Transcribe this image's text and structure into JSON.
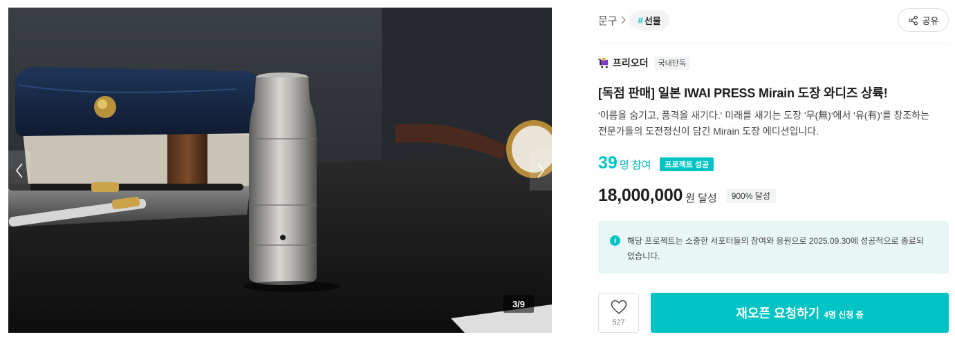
{
  "gallery": {
    "counter": "3/9",
    "prev_icon": "chevron-left-icon",
    "next_icon": "chevron-right-icon"
  },
  "breadcrumb": {
    "category": "문구",
    "tag_hash": "#",
    "tag": "선물"
  },
  "share": {
    "label": "공유",
    "icon": "share-icon"
  },
  "maker": {
    "name": "프리오더",
    "badge": "국내단독",
    "icon": "cart-logo-icon"
  },
  "project": {
    "title": "[독점 판매] 일본 IWAI PRESS Mirain 도장 와디즈 상륙!",
    "description": "'이름을 숨기고, 품격을 새기다.' 미래를 새기는 도장 '무(無)'에서 '유(有)'를 창조하는 전문가들의 도전정신이 담긴 Mirain 도장 에디션입니다."
  },
  "stats": {
    "participants": "39",
    "participants_unit": "명 참여",
    "status_badge": "프로젝트 성공",
    "amount": "18,000,000",
    "amount_unit": "원 달성",
    "rate_badge": "900% 달성"
  },
  "notice": {
    "icon": "info-icon",
    "text": "해당 프로젝트는 소중한 서포터들의 참여와 응원으로 2025.09.30에 성공적으로 종료되었습니다."
  },
  "actions": {
    "like_icon": "heart-icon",
    "like_count": "527",
    "reopen_label": "재오픈 요청하기",
    "reopen_sub": "4명 신청 중"
  },
  "colors": {
    "accent": "#00c4c4",
    "notice_bg": "#e8f6f6",
    "chip_bg": "#f1f3f5"
  }
}
